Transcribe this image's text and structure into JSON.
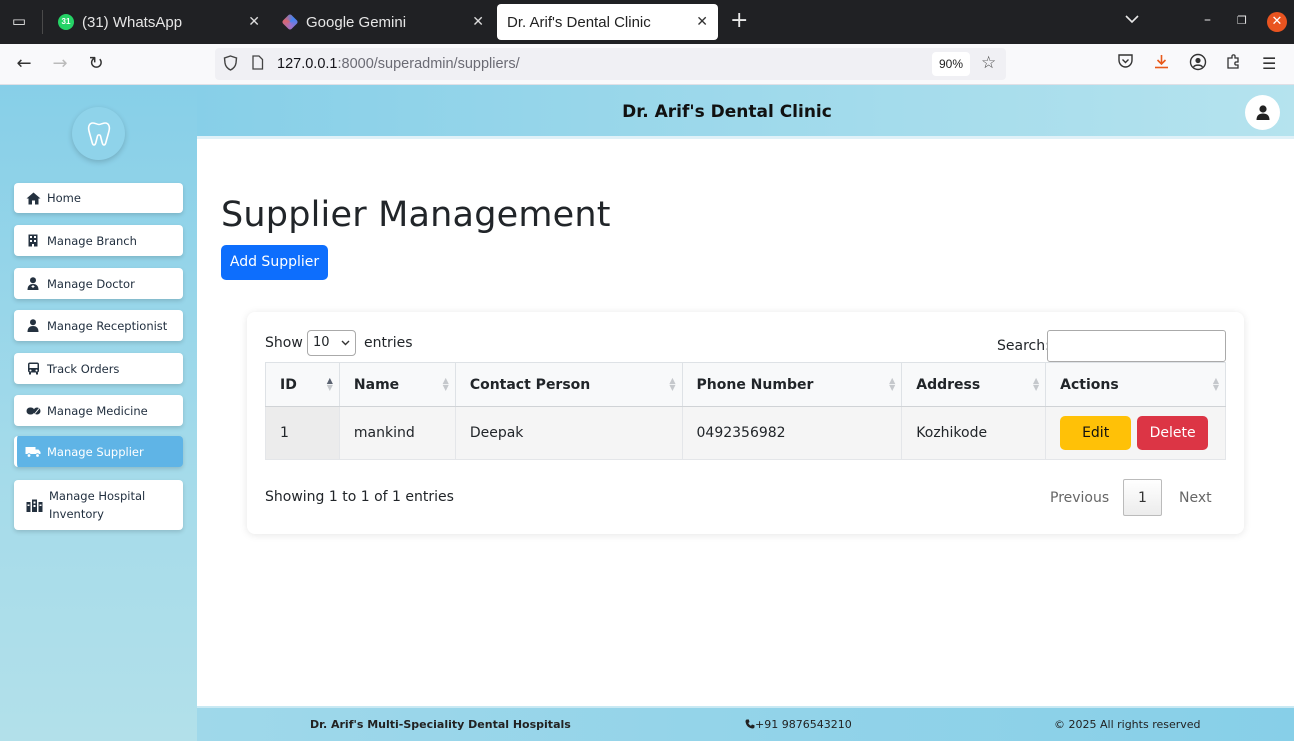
{
  "browser": {
    "tabs": [
      {
        "title": "(31) WhatsApp",
        "badge": "31"
      },
      {
        "title": "Google Gemini"
      },
      {
        "title": "Dr. Arif's Dental Clinic"
      }
    ],
    "url_host": "127.0.0.1",
    "url_path": ":8000/superadmin/suppliers/",
    "zoom": "90%"
  },
  "sidebar": {
    "items": [
      {
        "label": "Home",
        "icon": "home-icon"
      },
      {
        "label": "Manage Branch",
        "icon": "building-icon"
      },
      {
        "label": "Manage Doctor",
        "icon": "doctor-icon"
      },
      {
        "label": "Manage Receptionist",
        "icon": "receptionist-icon"
      },
      {
        "label": "Track Orders",
        "icon": "truck-icon"
      },
      {
        "label": "Manage Medicine",
        "icon": "pills-icon"
      },
      {
        "label": "Manage Supplier",
        "icon": "delivery-truck-icon"
      },
      {
        "label": "Manage Hospital Inventory",
        "icon": "inventory-icon"
      }
    ],
    "active_index": 6
  },
  "header": {
    "title": "Dr. Arif's Dental Clinic"
  },
  "main": {
    "page_title": "Supplier Management",
    "add_button": "Add Supplier",
    "table_controls": {
      "show_label": "Show",
      "entries_value": "10",
      "entries_label": "entries",
      "search_label": "Search:",
      "search_value": ""
    },
    "table": {
      "columns": [
        "ID",
        "Name",
        "Contact Person",
        "Phone Number",
        "Address",
        "Actions"
      ],
      "rows": [
        {
          "id": "1",
          "name": "mankind",
          "contact": "Deepak",
          "phone": "0492356982",
          "address": "Kozhikode",
          "edit": "Edit",
          "delete": "Delete"
        }
      ]
    },
    "info": "Showing 1 to 1 of 1 entries",
    "pagination": {
      "previous": "Previous",
      "page": "1",
      "next": "Next"
    }
  },
  "footer": {
    "name": "Dr. Arif's Multi-Speciality Dental Hospitals",
    "phone": "+91 9876543210",
    "copyright": "© 2025 All rights reserved"
  },
  "colors": {
    "primary": "#0d6efd",
    "warning": "#ffc107",
    "danger": "#dc3545",
    "sidebar": "#87cfe8"
  }
}
